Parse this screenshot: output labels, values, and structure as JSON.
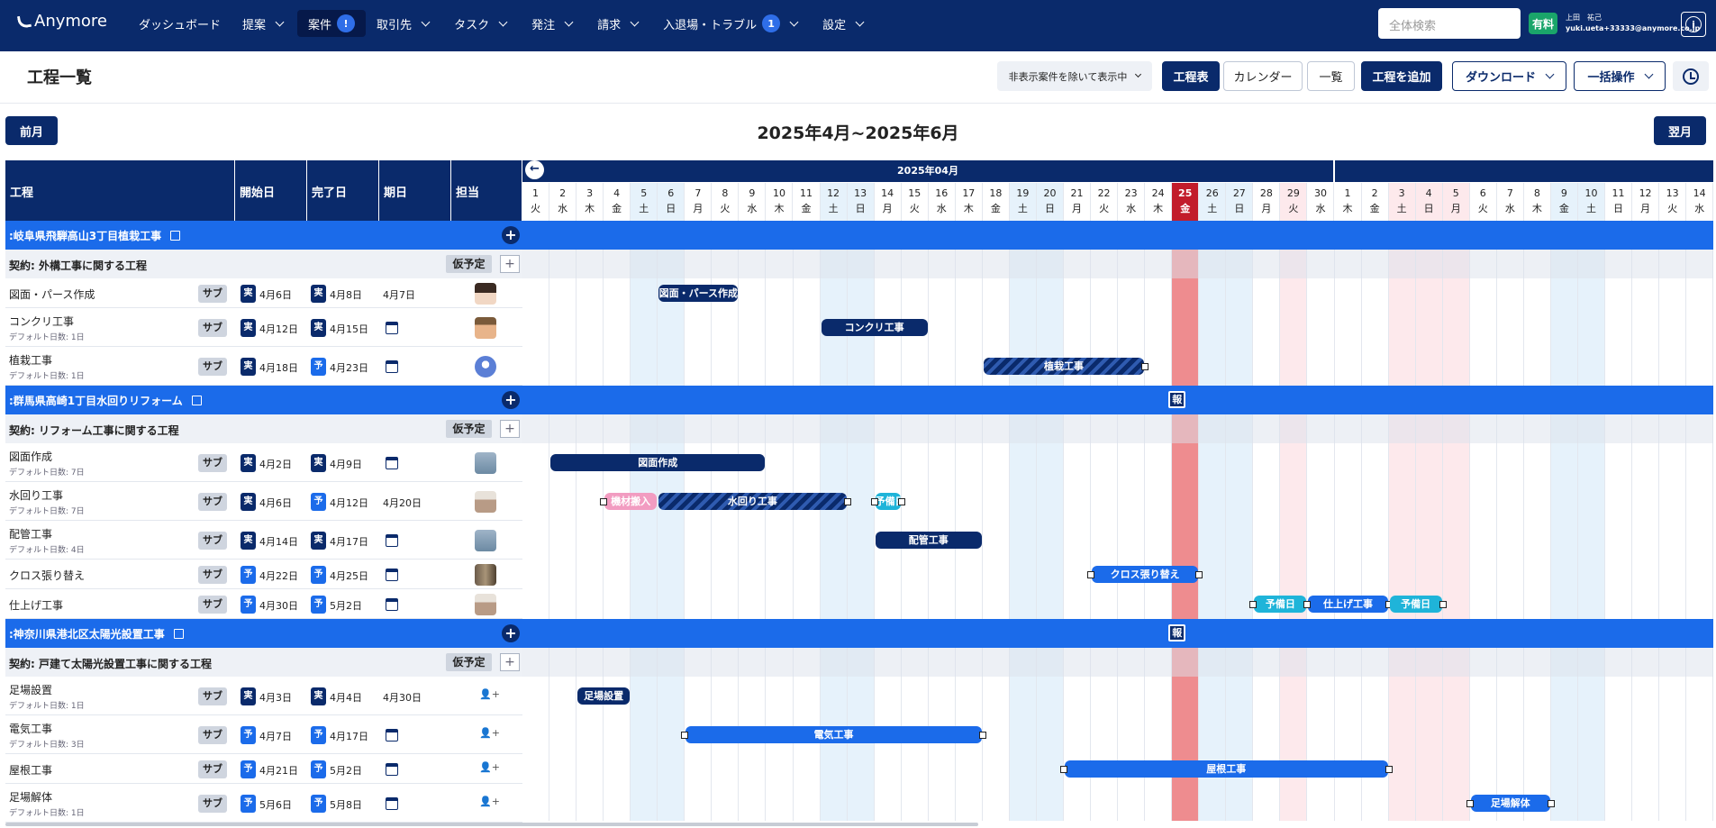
{
  "nav": {
    "logo": "Anymore",
    "items": [
      {
        "label": "ダッシュボード",
        "chevron": false
      },
      {
        "label": "提案",
        "chevron": true
      },
      {
        "label": "案件",
        "badge": "!",
        "active": true
      },
      {
        "label": "取引先",
        "chevron": true
      },
      {
        "label": "タスク",
        "chevron": true
      },
      {
        "label": "発注",
        "chevron": true
      },
      {
        "label": "請求",
        "chevron": true
      },
      {
        "label": "入退場・トラブル",
        "badge": "1",
        "chevron": true
      },
      {
        "label": "設定",
        "chevron": true
      }
    ],
    "search_placeholder": "全体検索",
    "plan_badge": "有料",
    "user_name": "上田　祐己",
    "user_email": "yuki.ueta+33333@anymore.co.jp"
  },
  "page": {
    "title": "工程一覧",
    "filter_label": "非表示案件を除いて表示中",
    "view_schedule": "工程表",
    "view_calendar": "カレンダー",
    "view_list": "一覧",
    "add_process": "工程を追加",
    "download": "ダウンロード",
    "bulk": "一括操作",
    "prev": "前月",
    "next": "翌月",
    "period": "2025年4月~2025年6月"
  },
  "grid": {
    "col_process": "工程",
    "col_start": "開始日",
    "col_end": "完了日",
    "col_due": "期日",
    "col_owner": "担当",
    "month_label": "2025年04月",
    "days": [
      {
        "d": "1",
        "w": "火"
      },
      {
        "d": "2",
        "w": "水"
      },
      {
        "d": "3",
        "w": "木"
      },
      {
        "d": "4",
        "w": "金"
      },
      {
        "d": "5",
        "w": "土"
      },
      {
        "d": "6",
        "w": "日"
      },
      {
        "d": "7",
        "w": "月"
      },
      {
        "d": "8",
        "w": "火"
      },
      {
        "d": "9",
        "w": "水"
      },
      {
        "d": "10",
        "w": "木"
      },
      {
        "d": "11",
        "w": "金"
      },
      {
        "d": "12",
        "w": "土"
      },
      {
        "d": "13",
        "w": "日"
      },
      {
        "d": "14",
        "w": "月"
      },
      {
        "d": "15",
        "w": "火"
      },
      {
        "d": "16",
        "w": "水"
      },
      {
        "d": "17",
        "w": "木"
      },
      {
        "d": "18",
        "w": "金"
      },
      {
        "d": "19",
        "w": "土"
      },
      {
        "d": "20",
        "w": "日"
      },
      {
        "d": "21",
        "w": "月"
      },
      {
        "d": "22",
        "w": "火"
      },
      {
        "d": "23",
        "w": "水"
      },
      {
        "d": "24",
        "w": "木"
      },
      {
        "d": "25",
        "w": "金"
      },
      {
        "d": "26",
        "w": "土"
      },
      {
        "d": "27",
        "w": "日"
      },
      {
        "d": "28",
        "w": "月"
      },
      {
        "d": "29",
        "w": "火"
      },
      {
        "d": "30",
        "w": "水"
      },
      {
        "d": "1",
        "w": "木"
      },
      {
        "d": "2",
        "w": "金"
      },
      {
        "d": "3",
        "w": "土"
      },
      {
        "d": "4",
        "w": "日"
      },
      {
        "d": "5",
        "w": "月"
      },
      {
        "d": "6",
        "w": "火"
      },
      {
        "d": "7",
        "w": "水"
      },
      {
        "d": "8",
        "w": "木"
      },
      {
        "d": "9",
        "w": "金"
      },
      {
        "d": "10",
        "w": "土"
      },
      {
        "d": "11",
        "w": "日"
      },
      {
        "d": "12",
        "w": "月"
      },
      {
        "d": "13",
        "w": "火"
      },
      {
        "d": "14",
        "w": "水"
      }
    ],
    "today_index": 24,
    "weekend_indices": [
      4,
      5,
      11,
      12,
      18,
      19,
      25,
      26,
      38,
      39
    ],
    "holiday_indices": [
      28,
      32,
      33,
      34
    ],
    "sub_label": "サブ",
    "tentative_label": "仮予定",
    "actual_tag": "実",
    "planned_tag": "予",
    "report_label": "報"
  },
  "projects": [
    {
      "name": ":岐阜県飛騨高山3丁目植栽工事",
      "contract": "契約: 外構工事に関する工程",
      "report": false,
      "rows": [
        {
          "name": "図面・パース作成",
          "sub": "",
          "st": "実",
          "start": "4月6日",
          "et": "実",
          "end": "4月8日",
          "due": "4月7日",
          "owner": "avatar-woman",
          "bars": [
            {
              "label": "図面・パース作成",
              "s": 5,
              "e": 7,
              "style": "navy"
            }
          ]
        },
        {
          "name": "コンクリ工事",
          "sub": "デフォルト日数: 1日",
          "st": "実",
          "start": "4月12日",
          "et": "実",
          "end": "4月15日",
          "due": "",
          "owner": "avatar-man",
          "bars": [
            {
              "label": "コンクリ工事",
              "s": 11,
              "e": 14,
              "style": "navy"
            }
          ]
        },
        {
          "name": "植栽工事",
          "sub": "デフォルト日数: 1日",
          "st": "実",
          "start": "4月18日",
          "et": "予",
          "end": "4月23日",
          "due": "",
          "owner": "avatar-default",
          "bars": [
            {
              "label": "植栽工事",
              "s": 17,
              "e": 22,
              "style": "hatch",
              "handleR": true
            }
          ]
        }
      ]
    },
    {
      "name": ":群馬県高崎1丁目水回りリフォーム",
      "contract": "契約: リフォーム工事に関する工程",
      "report": true,
      "rows": [
        {
          "name": "図面作成",
          "sub": "デフォルト日数: 7日",
          "st": "実",
          "start": "4月2日",
          "et": "実",
          "end": "4月9日",
          "due": "",
          "owner": "avatar-robot",
          "bars": [
            {
              "label": "図面作成",
              "s": 1,
              "e": 8,
              "style": "navy"
            }
          ]
        },
        {
          "name": "水回り工事",
          "sub": "デフォルト日数: 7日",
          "st": "実",
          "start": "4月6日",
          "et": "予",
          "end": "4月12日",
          "due": "4月20日",
          "owner": "avatar-woman2",
          "bars": [
            {
              "label": "機材搬入",
              "s": 3,
              "e": 4,
              "style": "pink",
              "handleL": true
            },
            {
              "label": "水回り工事",
              "s": 5,
              "e": 11,
              "style": "hatch",
              "handleR": true
            },
            {
              "label": "予備日",
              "s": 13,
              "e": 13,
              "style": "cyan",
              "handleL": true,
              "handleR": true
            }
          ]
        },
        {
          "name": "配管工事",
          "sub": "デフォルト日数: 4日",
          "st": "実",
          "start": "4月14日",
          "et": "実",
          "end": "4月17日",
          "due": "",
          "owner": "avatar-robot",
          "bars": [
            {
              "label": "配管工事",
              "s": 13,
              "e": 16,
              "style": "navy"
            }
          ]
        },
        {
          "name": "クロス張り替え",
          "sub": "",
          "st": "予",
          "start": "4月22日",
          "et": "予",
          "end": "4月25日",
          "due": "",
          "owner": "avatar-group",
          "bars": [
            {
              "label": "クロス張り替え",
              "s": 21,
              "e": 24,
              "style": "blue",
              "handleL": true,
              "handleR": true
            }
          ]
        },
        {
          "name": "仕上げ工事",
          "sub": "",
          "st": "予",
          "start": "4月30日",
          "et": "予",
          "end": "5月2日",
          "due": "",
          "owner": "avatar-woman2",
          "bars": [
            {
              "label": "予備日",
              "s": 27,
              "e": 28,
              "style": "cyan",
              "handleL": true
            },
            {
              "label": "仕上げ工事",
              "s": 29,
              "e": 31,
              "style": "blue",
              "handleL": true,
              "handleR": true
            },
            {
              "label": "予備日",
              "s": 32,
              "e": 33,
              "style": "cyan",
              "handleR": true
            }
          ]
        }
      ]
    },
    {
      "name": ":神奈川県港北区太陽光設置工事",
      "contract": "契約: 戸建て太陽光設置工事に関する工程",
      "report": true,
      "rows": [
        {
          "name": "足場設置",
          "sub": "デフォルト日数: 1日",
          "st": "実",
          "start": "4月3日",
          "et": "実",
          "end": "4月4日",
          "due": "4月30日",
          "owner": "add",
          "bars": [
            {
              "label": "足場設置",
              "s": 2,
              "e": 3,
              "style": "navy"
            }
          ]
        },
        {
          "name": "電気工事",
          "sub": "デフォルト日数: 3日",
          "st": "予",
          "start": "4月7日",
          "et": "予",
          "end": "4月17日",
          "due": "",
          "owner": "add",
          "bars": [
            {
              "label": "電気工事",
              "s": 6,
              "e": 16,
              "style": "blue",
              "handleL": true,
              "handleR": true
            }
          ]
        },
        {
          "name": "屋根工事",
          "sub": "",
          "st": "予",
          "start": "4月21日",
          "et": "予",
          "end": "5月2日",
          "due": "",
          "owner": "add",
          "bars": [
            {
              "label": "屋根工事",
              "s": 20,
              "e": 31,
              "style": "blue",
              "handleL": true,
              "handleR": true
            }
          ]
        },
        {
          "name": "足場解体",
          "sub": "デフォルト日数: 1日",
          "st": "予",
          "start": "5月6日",
          "et": "予",
          "end": "5月8日",
          "due": "",
          "owner": "add",
          "bars": [
            {
              "label": "足場解体",
              "s": 35,
              "e": 37,
              "style": "blue",
              "handleL": true,
              "handleR": true
            }
          ]
        }
      ]
    }
  ],
  "colors": {
    "navy": "#0a2a6b",
    "blue": "#1b6bea",
    "today": "#c21c2b",
    "weekend": "#e6f2fb",
    "holiday": "#fde9ec"
  }
}
